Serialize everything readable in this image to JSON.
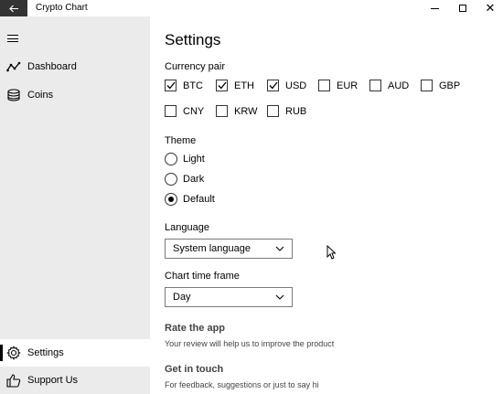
{
  "window": {
    "title": "Crypto Chart",
    "back_icon": "arrow-left-icon",
    "close_glyph": "✕"
  },
  "sidebar": {
    "items": [
      {
        "label": "Dashboard",
        "icon": "line-chart-icon"
      },
      {
        "label": "Coins",
        "icon": "coins-stack-icon"
      },
      {
        "label": "Settings",
        "icon": "gear-icon",
        "active": true
      },
      {
        "label": "Support Us",
        "icon": "thumbs-up-icon"
      }
    ]
  },
  "settings": {
    "title": "Settings",
    "currency": {
      "label": "Currency pair",
      "options": [
        {
          "label": "BTC",
          "checked": true
        },
        {
          "label": "ETH",
          "checked": true
        },
        {
          "label": "USD",
          "checked": true
        },
        {
          "label": "EUR",
          "checked": false
        },
        {
          "label": "AUD",
          "checked": false
        },
        {
          "label": "GBP",
          "checked": false
        },
        {
          "label": "CNY",
          "checked": false
        },
        {
          "label": "KRW",
          "checked": false
        },
        {
          "label": "RUB",
          "checked": false
        }
      ]
    },
    "theme": {
      "label": "Theme",
      "options": [
        {
          "label": "Light",
          "selected": false
        },
        {
          "label": "Dark",
          "selected": false
        },
        {
          "label": "Default",
          "selected": true
        }
      ]
    },
    "language": {
      "label": "Language",
      "value": "System language"
    },
    "timeframe": {
      "label": "Chart time frame",
      "value": "Day"
    },
    "rate": {
      "title": "Rate the app",
      "subtitle": "Your review will help us to improve the product"
    },
    "contact": {
      "title": "Get in touch",
      "subtitle": "For feedback, suggestions or just to say hi"
    }
  },
  "colors": {
    "sidebar_bg": "#ebebeb",
    "back_button_bg": "#333333",
    "accent": "#000000"
  }
}
